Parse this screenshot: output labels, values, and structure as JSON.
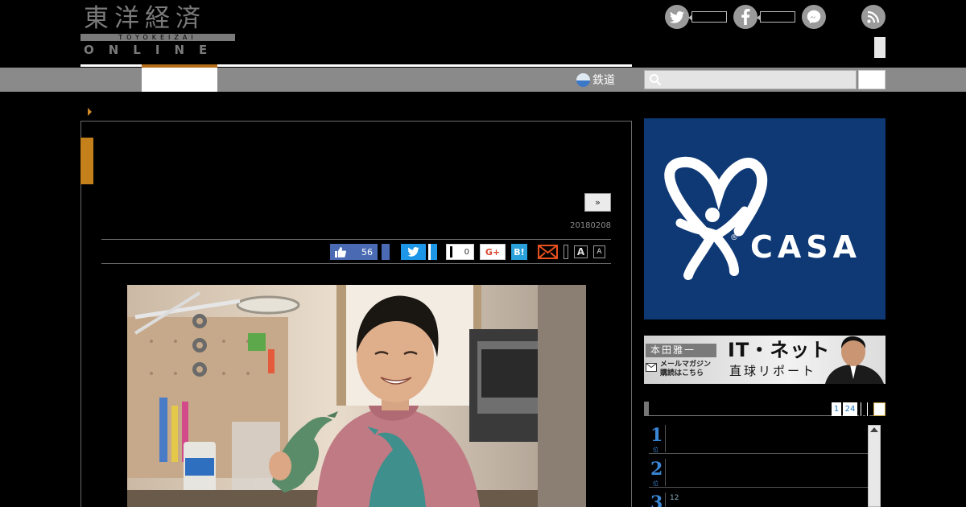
{
  "site": {
    "logo_kanji": "東洋経済",
    "logo_roman": "TOYOKEIZAI",
    "logo_online": "ONLINE"
  },
  "header": {
    "social": [
      {
        "name": "twitter",
        "icon": "twitter-icon",
        "color": "#9a9a9a"
      },
      {
        "name": "facebook",
        "icon": "facebook-icon",
        "color": "#9a9a9a"
      },
      {
        "name": "messenger",
        "icon": "messenger-icon",
        "color": "#9a9a9a"
      }
    ],
    "rss_icon": "rss-icon"
  },
  "nav": {
    "rail_label": "鉄道",
    "search_placeholder": "",
    "accent_color": "#b46d19"
  },
  "article": {
    "next_label": "»",
    "date": "20180208",
    "share": {
      "like_count": "56",
      "tweet_count": "0",
      "gplus_label": "G+",
      "hatena_label": "B!",
      "font_large": "A",
      "font_small": "A"
    }
  },
  "sidebar": {
    "ad_text": "CASA",
    "ad_reg": "®",
    "ad_color": "#0e3975",
    "banner": {
      "name": "本田雅一",
      "mail_text_1": "メールマガジン",
      "mail_text_2": "購読はこちら",
      "title": "IT・ネット",
      "subtitle": "直球リポート"
    },
    "ranking": {
      "tabs": [
        "1",
        "24"
      ],
      "items": [
        {
          "num": "1",
          "sub": "位",
          "meta": ""
        },
        {
          "num": "2",
          "sub": "位",
          "meta": ""
        },
        {
          "num": "3",
          "sub": "位",
          "meta": "12"
        }
      ]
    }
  }
}
